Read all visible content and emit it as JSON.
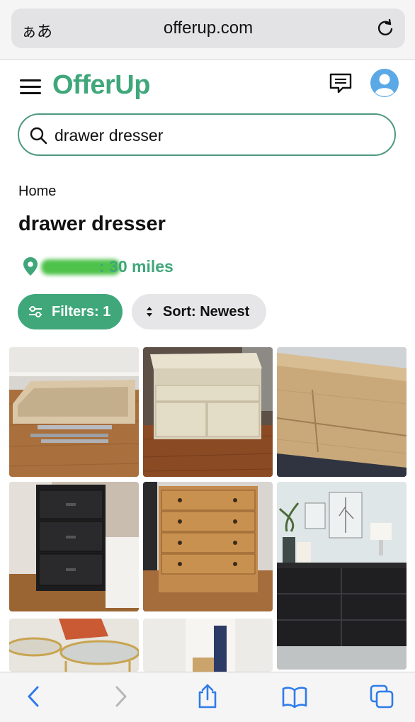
{
  "browser": {
    "text_size_label": "ぁあ",
    "url": "offerup.com"
  },
  "header": {
    "logo_text": "OfferUp"
  },
  "search": {
    "query": "drawer dresser"
  },
  "breadcrumb": "Home",
  "page_title": "drawer dresser",
  "location": {
    "distance_text": ": 30 miles"
  },
  "filters": {
    "filter_label": "Filters: 1",
    "sort_label": "Sort: Newest"
  },
  "listings": [
    {
      "description": "unassembled light wood drawer with rails"
    },
    {
      "description": "beige dresser with drawers and cabinet doors"
    },
    {
      "description": "light oak long dresser"
    },
    {
      "description": "black fabric 3-drawer chest"
    },
    {
      "description": "wood 5-drawer chest"
    },
    {
      "description": "black 6-drawer dresser"
    },
    {
      "description": "gold round side tables"
    },
    {
      "description": "room interior"
    }
  ],
  "colors": {
    "brand_green": "#3fa77a",
    "search_border": "#4e9a7e",
    "ios_blue": "#2f7bea"
  }
}
